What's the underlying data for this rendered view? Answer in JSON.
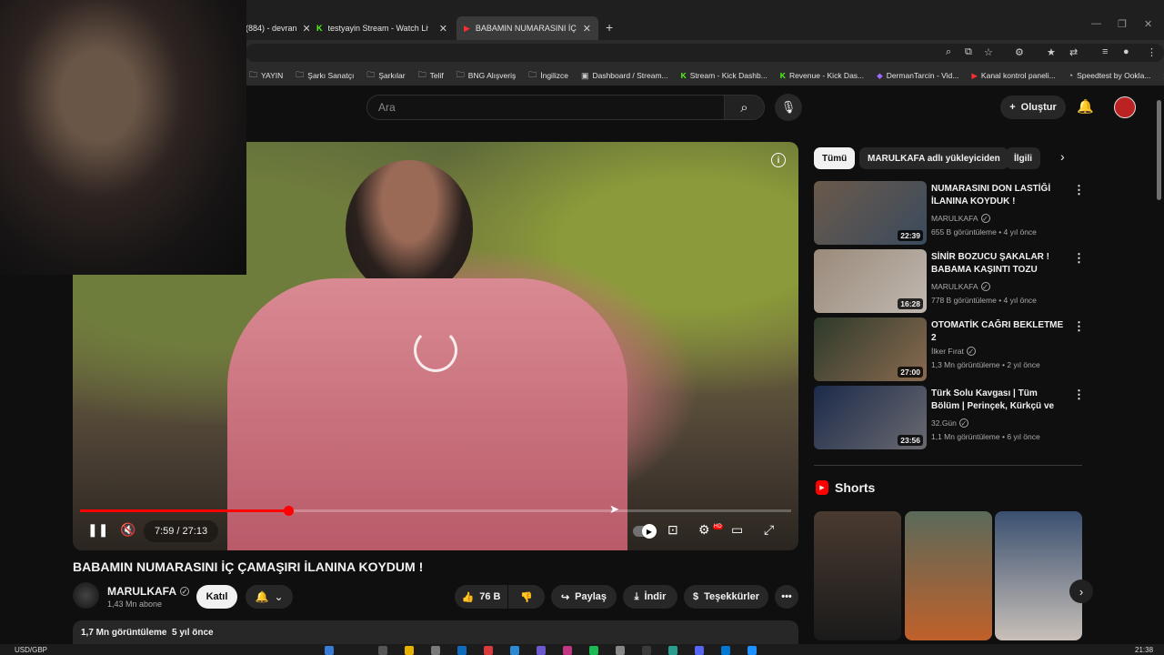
{
  "browser": {
    "tabs": [
      {
        "label": "(884) - devran",
        "icon": "twitch-icon"
      },
      {
        "label": "testyayin Stream - Watch Live o",
        "icon": "kick-icon"
      },
      {
        "label": "BABAMIN NUMARASINI İÇ ÇAM",
        "icon": "youtube-icon",
        "active": true
      }
    ],
    "new_tab": "+",
    "close": "✕",
    "bookmarks": [
      {
        "label": "YAYIN",
        "icon": "folder-icon"
      },
      {
        "label": "Şarkı Sanatçı",
        "icon": "folder-icon"
      },
      {
        "label": "Şarkılar",
        "icon": "folder-icon"
      },
      {
        "label": "Telif",
        "icon": "folder-icon"
      },
      {
        "label": "BNG Alışveriş",
        "icon": "folder-icon"
      },
      {
        "label": "İngilizce",
        "icon": "folder-icon"
      },
      {
        "label": "Dashboard / Stream...",
        "icon": "dashboard-icon"
      },
      {
        "label": "Stream - Kick Dashb...",
        "icon": "kick-icon"
      },
      {
        "label": "Revenue - Kick Das...",
        "icon": "kick-icon"
      },
      {
        "label": "DermanTarcin - Vid...",
        "icon": "twitch-icon"
      },
      {
        "label": "Kanal kontrol paneli...",
        "icon": "youtube-icon"
      },
      {
        "label": "Speedtest by Ookla...",
        "icon": "speedtest-icon"
      }
    ],
    "more_bookmarks": "»"
  },
  "youtube": {
    "search_placeholder": "Ara",
    "create_label": "Oluştur"
  },
  "player": {
    "current_time": "7:59",
    "separator": " / ",
    "duration": "27:13",
    "progress_fraction": 0.293,
    "hd_badge": "HD"
  },
  "video": {
    "title": "BABAMIN NUMARASINI İÇ ÇAMAŞIRI İLANINA KOYDUM !",
    "channel": "MARULKAFA",
    "subscribers": "1,43 Mn abone",
    "join_label": "Katıl",
    "likes": "76 B",
    "share_label": "Paylaş",
    "download_label": "İndir",
    "thanks_label": "Teşekkürler",
    "views": "1,7 Mn görüntüleme",
    "age": "5 yıl önce"
  },
  "chips": [
    "Tümü",
    "MARULKAFA adlı yükleyiciden",
    "İlgili"
  ],
  "recommendations": [
    {
      "title": "NUMARASINI DON LASTİĞİ İLANINA KOYDUK !",
      "channel": "MARULKAFA",
      "verified": true,
      "views": "655 B görüntüleme",
      "age": "4 yıl önce",
      "duration": "22:39",
      "colors": [
        "#6b5a4a",
        "#3a4a5e"
      ]
    },
    {
      "title": "SİNİR BOZUCU ŞAKALAR ! BABAMA KAŞINTI TOZU",
      "channel": "MARULKAFA",
      "verified": true,
      "views": "778 B görüntüleme",
      "age": "4 yıl önce",
      "duration": "16:28",
      "colors": [
        "#9a8a7a",
        "#c0b8b0"
      ]
    },
    {
      "title": "OTOMATİK CAĞRI BEKLETME 2",
      "channel": "İlker Fırat",
      "verified": true,
      "views": "1,3 Mn görüntüleme",
      "age": "2 yıl önce",
      "duration": "27:00",
      "colors": [
        "#2d3a2a",
        "#8a6a50"
      ]
    },
    {
      "title": "Türk Solu Kavgası | Tüm Bölüm | Perinçek, Kürkçü ve Uluer ...",
      "channel": "32.Gün",
      "verified": true,
      "views": "1,1 Mn görüntüleme",
      "age": "6 yıl önce",
      "duration": "23:56",
      "colors": [
        "#1c2a4a",
        "#6a6a70"
      ]
    }
  ],
  "shorts": {
    "title": "Shorts",
    "items": [
      {
        "colors": [
          "#4a3a30",
          "#1a1a1a"
        ]
      },
      {
        "colors": [
          "#5a6a5a",
          "#c0602a"
        ]
      },
      {
        "colors": [
          "#3a5070",
          "#c8c0b8"
        ]
      }
    ]
  },
  "taskbar": {
    "ticker": "USD/GBP",
    "clock": "21:38"
  }
}
